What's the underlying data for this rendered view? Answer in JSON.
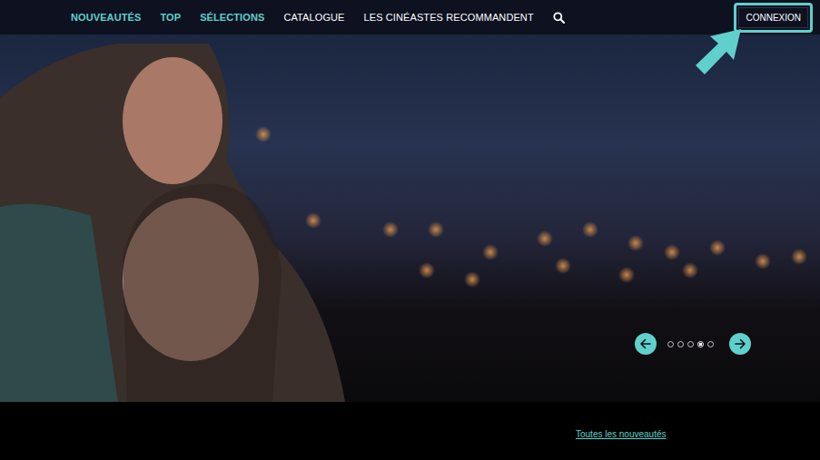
{
  "nav": {
    "items": [
      {
        "label": "NOUVEAUTÉS",
        "highlighted": true
      },
      {
        "label": "TOP",
        "highlighted": true
      },
      {
        "label": "SÉLECTIONS",
        "highlighted": true
      },
      {
        "label": "CATALOGUE",
        "highlighted": false
      },
      {
        "label": "LES CINÉASTES RECOMMANDENT",
        "highlighted": false
      }
    ]
  },
  "login_button": {
    "label": "CONNEXION"
  },
  "carousel": {
    "dots": [
      {
        "selected": false
      },
      {
        "selected": false
      },
      {
        "selected": false
      },
      {
        "selected": true
      },
      {
        "selected": false
      }
    ]
  },
  "all_news_link": "Toutes les nouveautés"
}
